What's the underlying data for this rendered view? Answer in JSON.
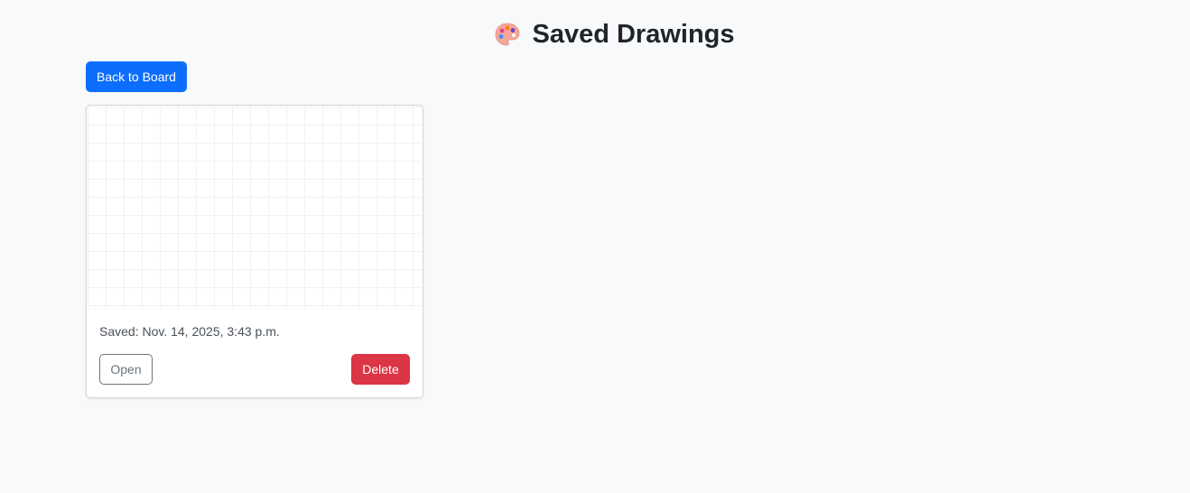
{
  "header": {
    "title": "Saved Drawings",
    "icon": "palette-icon"
  },
  "toolbar": {
    "back_label": "Back to Board"
  },
  "drawings": [
    {
      "saved_text": "Saved: Nov. 14, 2025, 3:43 p.m.",
      "open_label": "Open",
      "delete_label": "Delete"
    }
  ],
  "colors": {
    "primary": "#0d6efd",
    "danger": "#dc3545",
    "secondary": "#6c757d",
    "background": "#f8f9fa"
  }
}
